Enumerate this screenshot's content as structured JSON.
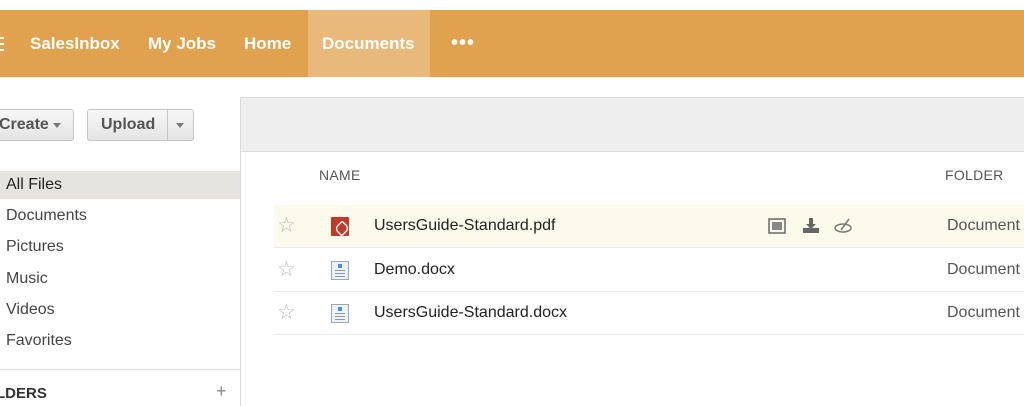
{
  "nav": {
    "items": [
      {
        "label": "SalesInbox"
      },
      {
        "label": "My Jobs"
      },
      {
        "label": "Home"
      },
      {
        "label": "Documents"
      }
    ],
    "more": "•••",
    "active": "Documents"
  },
  "toolbar": {
    "create_label": "Create",
    "upload_label": "Upload"
  },
  "sidebar": {
    "items": [
      {
        "label": "All Files"
      },
      {
        "label": "Documents"
      },
      {
        "label": "Pictures"
      },
      {
        "label": "Music"
      },
      {
        "label": "Videos"
      },
      {
        "label": "Favorites"
      }
    ],
    "active": "All Files",
    "folders_label": "LDERS",
    "folders_add": "+"
  },
  "files": {
    "columns": {
      "name": "NAME",
      "folder": "FOLDER"
    },
    "rows": [
      {
        "name": "UsersGuide-Standard.pdf",
        "folder": "Document",
        "icon": "pdf-file-icon",
        "highlighted": true
      },
      {
        "name": "Demo.docx",
        "folder": "Document",
        "icon": "doc-file-icon",
        "highlighted": false
      },
      {
        "name": "UsersGuide-Standard.docx",
        "folder": "Document",
        "icon": "doc-file-icon",
        "highlighted": false
      }
    ],
    "row_actions": [
      "preview-icon",
      "download-icon",
      "share-icon"
    ]
  },
  "colors": {
    "navbar": "#e0a24e",
    "navbar_active": "#e8b97a",
    "row_highlight": "#fcfbeb",
    "pdf": "#c0392b"
  }
}
